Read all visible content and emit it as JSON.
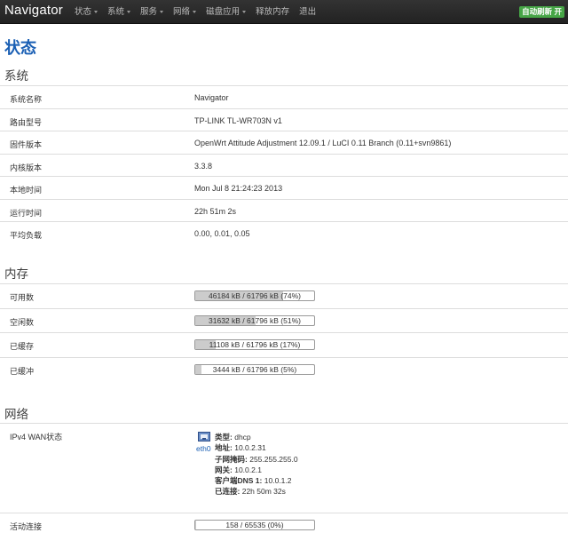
{
  "navbar": {
    "brand": "Navigator",
    "menu": [
      {
        "label": "状态",
        "has_dropdown": true
      },
      {
        "label": "系统",
        "has_dropdown": true
      },
      {
        "label": "服务",
        "has_dropdown": true
      },
      {
        "label": "网络",
        "has_dropdown": true
      },
      {
        "label": "磁盘应用",
        "has_dropdown": true
      },
      {
        "label": "释放内存",
        "has_dropdown": false
      },
      {
        "label": "退出",
        "has_dropdown": false
      }
    ],
    "refresh_button": "自动刷新 开"
  },
  "page_title": "状态",
  "system": {
    "title": "系统",
    "rows": [
      {
        "label": "系统名称",
        "value": "Navigator"
      },
      {
        "label": "路由型号",
        "value": "TP-LINK TL-WR703N v1"
      },
      {
        "label": "固件版本",
        "value": "OpenWrt Attitude Adjustment 12.09.1 / LuCI 0.11 Branch (0.11+svn9861)"
      },
      {
        "label": "内核版本",
        "value": "3.3.8"
      },
      {
        "label": "本地时间",
        "value": "Mon Jul 8 21:24:23 2013"
      },
      {
        "label": "运行时间",
        "value": "22h 51m 2s"
      },
      {
        "label": "平均负载",
        "value": "0.00, 0.01, 0.05"
      }
    ]
  },
  "memory": {
    "title": "内存",
    "rows": [
      {
        "label": "可用数",
        "bar_text": "46184 kB / 61796 kB (74%)",
        "fraction": 0.74
      },
      {
        "label": "空闲数",
        "bar_text": "31632 kB / 61796 kB (51%)",
        "fraction": 0.51
      },
      {
        "label": "已缓存",
        "bar_text": "11108 kB / 61796 kB (17%)",
        "fraction": 0.17
      },
      {
        "label": "已缓冲",
        "bar_text": "3444 kB / 61796 kB (5%)",
        "fraction": 0.05
      }
    ]
  },
  "network": {
    "title": "网络",
    "wan": {
      "label": "IPv4 WAN状态",
      "icon": "ethernet-port-icon",
      "iface": "eth0",
      "lines": [
        {
          "key": "类型:",
          "value": "dhcp"
        },
        {
          "key": "地址:",
          "value": "10.0.2.31"
        },
        {
          "key": "子网掩码:",
          "value": "255.255.255.0"
        },
        {
          "key": "网关:",
          "value": "10.0.2.1"
        },
        {
          "key": "客户端DNS 1:",
          "value": "10.0.1.2"
        },
        {
          "key": "已连接:",
          "value": "22h 50m 32s"
        }
      ]
    },
    "active_conn": {
      "label": "活动连接",
      "bar_text": "158 / 65535 (0%)",
      "fraction": 0.0024
    }
  },
  "colors": {
    "accent": "#1a5fb4",
    "navbar": "#222222",
    "refresh": "#46a546",
    "bar_fill": "#cccccc"
  }
}
